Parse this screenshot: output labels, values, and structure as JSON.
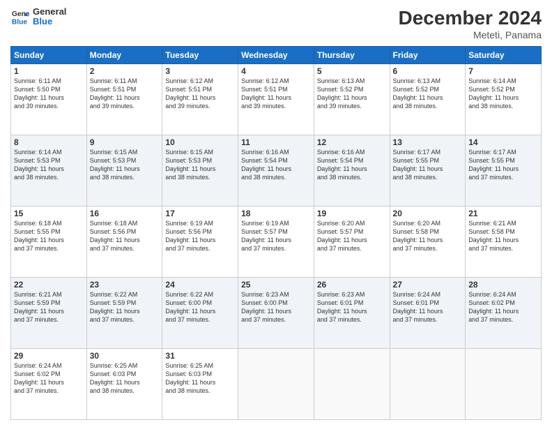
{
  "logo": {
    "general": "General",
    "blue": "Blue"
  },
  "title": "December 2024",
  "subtitle": "Meteti, Panama",
  "days_header": [
    "Sunday",
    "Monday",
    "Tuesday",
    "Wednesday",
    "Thursday",
    "Friday",
    "Saturday"
  ],
  "weeks": [
    [
      {
        "day": "1",
        "sunrise": "6:11 AM",
        "sunset": "5:50 PM",
        "daylight": "11 hours and 39 minutes."
      },
      {
        "day": "2",
        "sunrise": "6:11 AM",
        "sunset": "5:51 PM",
        "daylight": "11 hours and 39 minutes."
      },
      {
        "day": "3",
        "sunrise": "6:12 AM",
        "sunset": "5:51 PM",
        "daylight": "11 hours and 39 minutes."
      },
      {
        "day": "4",
        "sunrise": "6:12 AM",
        "sunset": "5:51 PM",
        "daylight": "11 hours and 39 minutes."
      },
      {
        "day": "5",
        "sunrise": "6:13 AM",
        "sunset": "5:52 PM",
        "daylight": "11 hours and 39 minutes."
      },
      {
        "day": "6",
        "sunrise": "6:13 AM",
        "sunset": "5:52 PM",
        "daylight": "11 hours and 38 minutes."
      },
      {
        "day": "7",
        "sunrise": "6:14 AM",
        "sunset": "5:52 PM",
        "daylight": "11 hours and 38 minutes."
      }
    ],
    [
      {
        "day": "8",
        "sunrise": "6:14 AM",
        "sunset": "5:53 PM",
        "daylight": "11 hours and 38 minutes."
      },
      {
        "day": "9",
        "sunrise": "6:15 AM",
        "sunset": "5:53 PM",
        "daylight": "11 hours and 38 minutes."
      },
      {
        "day": "10",
        "sunrise": "6:15 AM",
        "sunset": "5:53 PM",
        "daylight": "11 hours and 38 minutes."
      },
      {
        "day": "11",
        "sunrise": "6:16 AM",
        "sunset": "5:54 PM",
        "daylight": "11 hours and 38 minutes."
      },
      {
        "day": "12",
        "sunrise": "6:16 AM",
        "sunset": "5:54 PM",
        "daylight": "11 hours and 38 minutes."
      },
      {
        "day": "13",
        "sunrise": "6:17 AM",
        "sunset": "5:55 PM",
        "daylight": "11 hours and 38 minutes."
      },
      {
        "day": "14",
        "sunrise": "6:17 AM",
        "sunset": "5:55 PM",
        "daylight": "11 hours and 37 minutes."
      }
    ],
    [
      {
        "day": "15",
        "sunrise": "6:18 AM",
        "sunset": "5:55 PM",
        "daylight": "11 hours and 37 minutes."
      },
      {
        "day": "16",
        "sunrise": "6:18 AM",
        "sunset": "5:56 PM",
        "daylight": "11 hours and 37 minutes."
      },
      {
        "day": "17",
        "sunrise": "6:19 AM",
        "sunset": "5:56 PM",
        "daylight": "11 hours and 37 minutes."
      },
      {
        "day": "18",
        "sunrise": "6:19 AM",
        "sunset": "5:57 PM",
        "daylight": "11 hours and 37 minutes."
      },
      {
        "day": "19",
        "sunrise": "6:20 AM",
        "sunset": "5:57 PM",
        "daylight": "11 hours and 37 minutes."
      },
      {
        "day": "20",
        "sunrise": "6:20 AM",
        "sunset": "5:58 PM",
        "daylight": "11 hours and 37 minutes."
      },
      {
        "day": "21",
        "sunrise": "6:21 AM",
        "sunset": "5:58 PM",
        "daylight": "11 hours and 37 minutes."
      }
    ],
    [
      {
        "day": "22",
        "sunrise": "6:21 AM",
        "sunset": "5:59 PM",
        "daylight": "11 hours and 37 minutes."
      },
      {
        "day": "23",
        "sunrise": "6:22 AM",
        "sunset": "5:59 PM",
        "daylight": "11 hours and 37 minutes."
      },
      {
        "day": "24",
        "sunrise": "6:22 AM",
        "sunset": "6:00 PM",
        "daylight": "11 hours and 37 minutes."
      },
      {
        "day": "25",
        "sunrise": "6:23 AM",
        "sunset": "6:00 PM",
        "daylight": "11 hours and 37 minutes."
      },
      {
        "day": "26",
        "sunrise": "6:23 AM",
        "sunset": "6:01 PM",
        "daylight": "11 hours and 37 minutes."
      },
      {
        "day": "27",
        "sunrise": "6:24 AM",
        "sunset": "6:01 PM",
        "daylight": "11 hours and 37 minutes."
      },
      {
        "day": "28",
        "sunrise": "6:24 AM",
        "sunset": "6:02 PM",
        "daylight": "11 hours and 37 minutes."
      }
    ],
    [
      {
        "day": "29",
        "sunrise": "6:24 AM",
        "sunset": "6:02 PM",
        "daylight": "11 hours and 37 minutes."
      },
      {
        "day": "30",
        "sunrise": "6:25 AM",
        "sunset": "6:03 PM",
        "daylight": "11 hours and 38 minutes."
      },
      {
        "day": "31",
        "sunrise": "6:25 AM",
        "sunset": "6:03 PM",
        "daylight": "11 hours and 38 minutes."
      },
      null,
      null,
      null,
      null
    ]
  ]
}
